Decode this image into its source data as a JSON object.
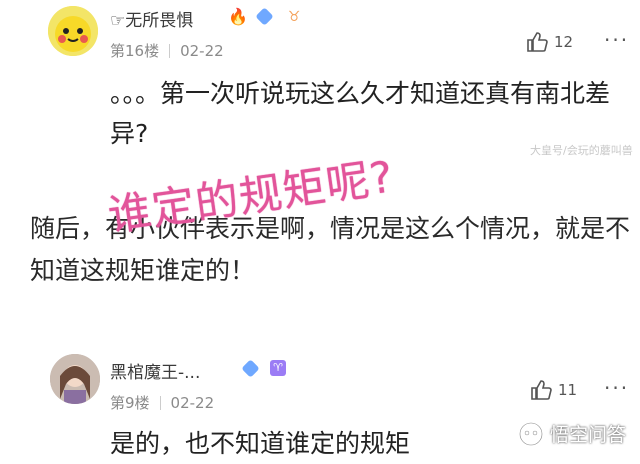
{
  "comments": [
    {
      "username": "☞无所畏惧",
      "floor": "第16楼",
      "date": "02-22",
      "likes": "12",
      "text": "。。。第一次听说玩这么久才知道还真有南北差异?"
    },
    {
      "username": "黑棺魔王-...",
      "floor": "第9楼",
      "date": "02-22",
      "likes": "11",
      "text": "是的，也不知道谁定的规矩"
    }
  ],
  "image_watermark": "大皇号/会玩的蘑叫兽",
  "middle_text": "随后，有小伙伴表示是啊，情况是这么个情况，就是不知道这规矩谁定的！",
  "overlay_text": "谁定的规矩呢?",
  "site_watermark": "悟空问答",
  "colors": {
    "overlay": "#e2549a",
    "diamond": "#6fa8ff",
    "aries": "#9b7cf5",
    "fire": "#ff7a1a"
  }
}
